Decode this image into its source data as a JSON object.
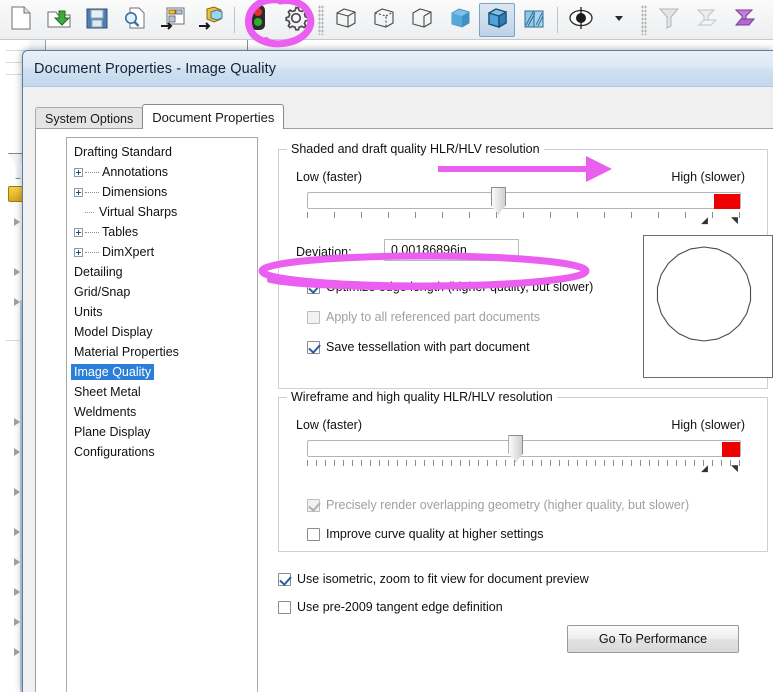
{
  "toolbar": {
    "icons": [
      {
        "name": "new-document-icon",
        "label": "New"
      },
      {
        "name": "open-folder-icon",
        "label": "Open"
      },
      {
        "name": "save-icon",
        "label": "Save"
      },
      {
        "name": "print-preview-icon",
        "label": "Print Preview"
      },
      {
        "name": "make-drawing-from-part-icon",
        "label": "Make Drawing from Part"
      },
      {
        "name": "make-assembly-from-part-icon",
        "label": "Make Assembly from Part"
      },
      {
        "name": "rebuild-traffic-light-icon",
        "label": "Rebuild"
      },
      {
        "name": "options-gear-icon",
        "label": "Options"
      },
      {
        "name": "display-wireframe-icon",
        "label": "Wireframe"
      },
      {
        "name": "display-hidden-lines-visible-icon",
        "label": "Hidden Lines Visible"
      },
      {
        "name": "display-hidden-lines-removed-icon",
        "label": "Hidden Lines Removed"
      },
      {
        "name": "display-shaded-icon",
        "label": "Shaded"
      },
      {
        "name": "display-shaded-with-edges-icon",
        "label": "Shaded With Edges"
      },
      {
        "name": "section-view-icon",
        "label": "Section View"
      },
      {
        "name": "view-orientation-icon",
        "label": "View Orientation"
      },
      {
        "name": "view-orientation-dropdown-arrow-icon",
        "label": "View Orientation Dropdown"
      },
      {
        "name": "draft-quality-filter-icon",
        "label": "Filter"
      },
      {
        "name": "appearance-filter-icon",
        "label": "Appearance Filter"
      },
      {
        "name": "appearances-scenes-icon",
        "label": "Appearances, Scenes and Decals"
      }
    ],
    "active_icon": "display-shaded-with-edges-icon"
  },
  "dialog": {
    "title": "Document Properties - Image Quality",
    "tabs": [
      {
        "label": "System Options",
        "selected": false
      },
      {
        "label": "Document Properties",
        "selected": true
      }
    ]
  },
  "tree": {
    "items": [
      {
        "label": "Drafting Standard",
        "indent": 0,
        "expander": "none",
        "selected": false
      },
      {
        "label": "Annotations",
        "indent": 1,
        "expander": "plus",
        "selected": false
      },
      {
        "label": "Dimensions",
        "indent": 1,
        "expander": "plus",
        "selected": false
      },
      {
        "label": "Virtual Sharps",
        "indent": 1,
        "expander": "stub",
        "selected": false
      },
      {
        "label": "Tables",
        "indent": 1,
        "expander": "plus",
        "selected": false
      },
      {
        "label": "DimXpert",
        "indent": 1,
        "expander": "plus",
        "selected": false
      },
      {
        "label": "Detailing",
        "indent": 0,
        "expander": "none",
        "selected": false
      },
      {
        "label": "Grid/Snap",
        "indent": 0,
        "expander": "none",
        "selected": false
      },
      {
        "label": "Units",
        "indent": 0,
        "expander": "none",
        "selected": false
      },
      {
        "label": "Model Display",
        "indent": 0,
        "expander": "none",
        "selected": false
      },
      {
        "label": "Material Properties",
        "indent": 0,
        "expander": "none",
        "selected": false
      },
      {
        "label": "Image Quality",
        "indent": 0,
        "expander": "none",
        "selected": true
      },
      {
        "label": "Sheet Metal",
        "indent": 0,
        "expander": "none",
        "selected": false
      },
      {
        "label": "Weldments",
        "indent": 0,
        "expander": "none",
        "selected": false
      },
      {
        "label": "Plane Display",
        "indent": 0,
        "expander": "none",
        "selected": false
      },
      {
        "label": "Configurations",
        "indent": 0,
        "expander": "none",
        "selected": false
      }
    ]
  },
  "shaded_group": {
    "legend": "Shaded and draft quality HLR/HLV resolution",
    "slider": {
      "low_label": "Low (faster)",
      "high_label": "High (slower)",
      "value_fraction": 0.44,
      "tick_count": 17,
      "red_zone_color": "#ee0000",
      "red_zone_start_fraction": 0.935
    },
    "deviation_label": "Deviation:",
    "deviation_value": "0.00186896in",
    "checkboxes": [
      {
        "label": "Optimize edge length (higher quality, but slower)",
        "checked": true,
        "disabled": false
      },
      {
        "label": "Apply to all referenced part documents",
        "checked": false,
        "disabled": true
      },
      {
        "label": "Save tessellation with part document",
        "checked": true,
        "disabled": false
      }
    ]
  },
  "wireframe_group": {
    "legend": "Wireframe and high quality HLR/HLV resolution",
    "slider": {
      "low_label": "Low (faster)",
      "high_label": "High (slower)",
      "value_fraction": 0.48,
      "tick_count": 49,
      "red_zone_color": "#ee0000",
      "red_zone_start_fraction": 0.955
    },
    "checkboxes": [
      {
        "label": "Precisely render overlapping geometry (higher quality, but slower)",
        "checked": true,
        "disabled": true
      },
      {
        "label": "Improve curve quality at higher settings",
        "checked": false,
        "disabled": false
      }
    ]
  },
  "bottom": {
    "checkboxes": [
      {
        "label": "Use isometric, zoom to fit view for document preview",
        "checked": true,
        "disabled": false
      },
      {
        "label": "Use pre-2009 tangent edge definition",
        "checked": false,
        "disabled": false
      }
    ],
    "button_label": "Go To Performance"
  },
  "preview": {
    "name": "tessellation-preview",
    "shape": "faceted-circle",
    "facet_count": 22
  },
  "annotations": {
    "color": "#ea5ef0",
    "items": [
      {
        "name": "gear-icon-circle-highlight",
        "kind": "circle"
      },
      {
        "name": "slider-direction-arrow",
        "kind": "arrow"
      },
      {
        "name": "optimize-edge-length-highlight",
        "kind": "ellipse"
      }
    ]
  }
}
